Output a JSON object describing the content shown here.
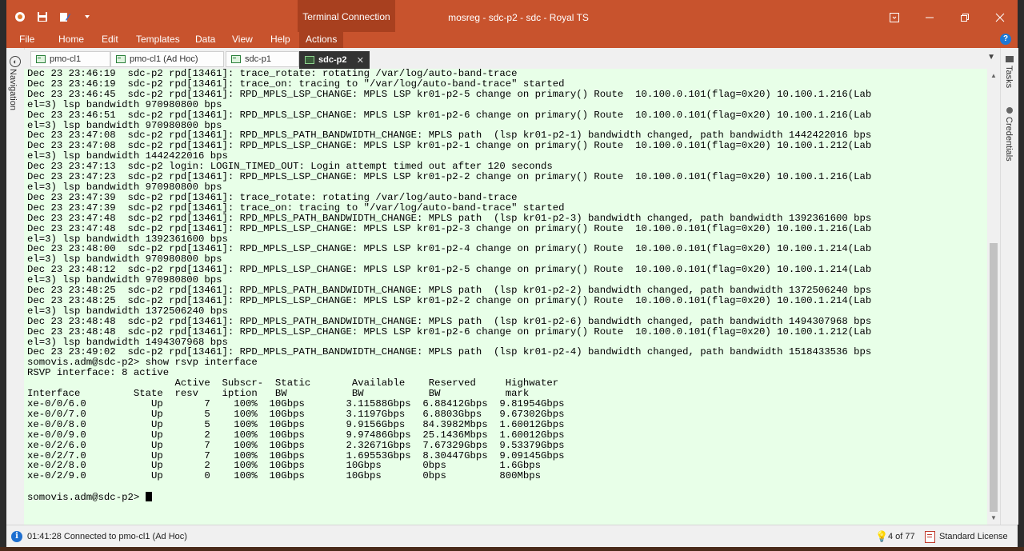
{
  "titlebar": {
    "context_tab": "Terminal Connection",
    "title": "mosreg - sdc-p2 - sdc - Royal TS"
  },
  "menu": {
    "items": [
      "File",
      "Home",
      "Edit",
      "Templates",
      "Data",
      "View",
      "Help",
      "Actions"
    ],
    "active": "Actions",
    "help_label": "?"
  },
  "sidebar_left": {
    "label": "Navigation"
  },
  "sidebar_right": {
    "items": [
      "Tasks",
      "Credentials"
    ]
  },
  "tabs": [
    {
      "label": "pmo-cl1",
      "active": false
    },
    {
      "label": "pmo-cl1 (Ad Hoc)",
      "active": false
    },
    {
      "label": "sdc-p1",
      "active": false
    },
    {
      "label": "sdc-p2",
      "active": true
    }
  ],
  "terminal": {
    "lines": [
      "Dec 23 23:46:19  sdc-p2 rpd[13461]: trace_rotate: rotating /var/log/auto-band-trace",
      "Dec 23 23:46:19  sdc-p2 rpd[13461]: trace_on: tracing to \"/var/log/auto-band-trace\" started",
      "Dec 23 23:46:45  sdc-p2 rpd[13461]: RPD_MPLS_LSP_CHANGE: MPLS LSP kr01-p2-5 change on primary() Route  10.100.0.101(flag=0x20) 10.100.1.216(Lab",
      "el=3) lsp bandwidth 970980800 bps",
      "Dec 23 23:46:51  sdc-p2 rpd[13461]: RPD_MPLS_LSP_CHANGE: MPLS LSP kr01-p2-6 change on primary() Route  10.100.0.101(flag=0x20) 10.100.1.216(Lab",
      "el=3) lsp bandwidth 970980800 bps",
      "Dec 23 23:47:08  sdc-p2 rpd[13461]: RPD_MPLS_PATH_BANDWIDTH_CHANGE: MPLS path  (lsp kr01-p2-1) bandwidth changed, path bandwidth 1442422016 bps",
      "Dec 23 23:47:08  sdc-p2 rpd[13461]: RPD_MPLS_LSP_CHANGE: MPLS LSP kr01-p2-1 change on primary() Route  10.100.0.101(flag=0x20) 10.100.1.212(Lab",
      "el=3) lsp bandwidth 1442422016 bps",
      "Dec 23 23:47:13  sdc-p2 login: LOGIN_TIMED_OUT: Login attempt timed out after 120 seconds",
      "Dec 23 23:47:23  sdc-p2 rpd[13461]: RPD_MPLS_LSP_CHANGE: MPLS LSP kr01-p2-2 change on primary() Route  10.100.0.101(flag=0x20) 10.100.1.216(Lab",
      "el=3) lsp bandwidth 970980800 bps",
      "Dec 23 23:47:39  sdc-p2 rpd[13461]: trace_rotate: rotating /var/log/auto-band-trace",
      "Dec 23 23:47:39  sdc-p2 rpd[13461]: trace_on: tracing to \"/var/log/auto-band-trace\" started",
      "Dec 23 23:47:48  sdc-p2 rpd[13461]: RPD_MPLS_PATH_BANDWIDTH_CHANGE: MPLS path  (lsp kr01-p2-3) bandwidth changed, path bandwidth 1392361600 bps",
      "Dec 23 23:47:48  sdc-p2 rpd[13461]: RPD_MPLS_LSP_CHANGE: MPLS LSP kr01-p2-3 change on primary() Route  10.100.0.101(flag=0x20) 10.100.1.216(Lab",
      "el=3) lsp bandwidth 1392361600 bps",
      "Dec 23 23:48:00  sdc-p2 rpd[13461]: RPD_MPLS_LSP_CHANGE: MPLS LSP kr01-p2-4 change on primary() Route  10.100.0.101(flag=0x20) 10.100.1.214(Lab",
      "el=3) lsp bandwidth 970980800 bps",
      "Dec 23 23:48:12  sdc-p2 rpd[13461]: RPD_MPLS_LSP_CHANGE: MPLS LSP kr01-p2-5 change on primary() Route  10.100.0.101(flag=0x20) 10.100.1.214(Lab",
      "el=3) lsp bandwidth 970980800 bps",
      "Dec 23 23:48:25  sdc-p2 rpd[13461]: RPD_MPLS_PATH_BANDWIDTH_CHANGE: MPLS path  (lsp kr01-p2-2) bandwidth changed, path bandwidth 1372506240 bps",
      "Dec 23 23:48:25  sdc-p2 rpd[13461]: RPD_MPLS_LSP_CHANGE: MPLS LSP kr01-p2-2 change on primary() Route  10.100.0.101(flag=0x20) 10.100.1.214(Lab",
      "el=3) lsp bandwidth 1372506240 bps",
      "Dec 23 23:48:48  sdc-p2 rpd[13461]: RPD_MPLS_PATH_BANDWIDTH_CHANGE: MPLS path  (lsp kr01-p2-6) bandwidth changed, path bandwidth 1494307968 bps",
      "Dec 23 23:48:48  sdc-p2 rpd[13461]: RPD_MPLS_LSP_CHANGE: MPLS LSP kr01-p2-6 change on primary() Route  10.100.0.101(flag=0x20) 10.100.1.212(Lab",
      "el=3) lsp bandwidth 1494307968 bps",
      "Dec 23 23:49:02  sdc-p2 rpd[13461]: RPD_MPLS_PATH_BANDWIDTH_CHANGE: MPLS path  (lsp kr01-p2-4) bandwidth changed, path bandwidth 1518433536 bps",
      "",
      "somovis.adm@sdc-p2> show rsvp interface",
      "RSVP interface: 8 active",
      "                         Active  Subscr-  Static       Available    Reserved     Highwater",
      "Interface         State  resv    iption   BW           BW           BW           mark",
      "xe-0/0/6.0           Up       7    100%  10Gbps       3.11588Gbps  6.88412Gbps  9.81954Gbps",
      "xe-0/0/7.0           Up       5    100%  10Gbps       3.1197Gbps   6.8803Gbps   9.67302Gbps",
      "xe-0/0/8.0           Up       5    100%  10Gbps       9.9156Gbps   84.3982Mbps  1.60012Gbps",
      "xe-0/0/9.0           Up       2    100%  10Gbps       9.97486Gbps  25.1436Mbps  1.60012Gbps",
      "xe-0/2/6.0           Up       7    100%  10Gbps       2.32671Gbps  7.67329Gbps  9.53379Gbps",
      "xe-0/2/7.0           Up       7    100%  10Gbps       1.69553Gbps  8.30447Gbps  9.09145Gbps",
      "xe-0/2/8.0           Up       2    100%  10Gbps       10Gbps       0bps         1.6Gbps",
      "xe-0/2/9.0           Up       0    100%  10Gbps       10Gbps       0bps         800Mbps",
      ""
    ],
    "prompt": "somovis.adm@sdc-p2> "
  },
  "status": {
    "message": "01:41:28 Connected to pmo-cl1 (Ad Hoc)",
    "count": "4 of 77",
    "license": "Standard License"
  },
  "colors": {
    "titlebar": "#c8532d",
    "active_menu": "#a8401f",
    "terminal_bg": "#e8ffe8"
  }
}
